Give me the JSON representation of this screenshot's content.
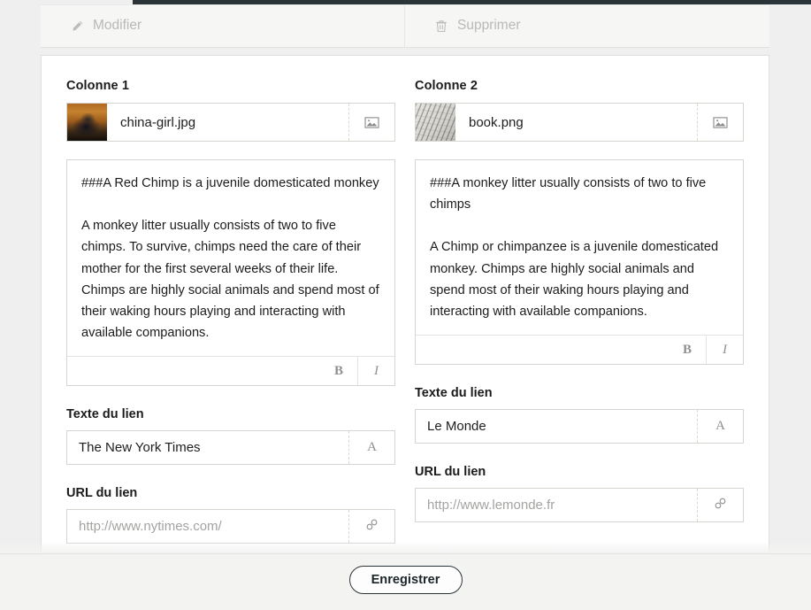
{
  "toolbar": {
    "buttons": [
      {
        "label": "Modifier",
        "icon": "pencil-icon"
      },
      {
        "label": "Supprimer",
        "icon": "trash-icon"
      }
    ]
  },
  "columns": [
    {
      "title": "Colonne 1",
      "file": {
        "name": "china-girl.jpg",
        "button_icon": "image-icon"
      },
      "body": {
        "heading": "###A Red Chimp is a juvenile domesticated monkey",
        "paragraph": "A monkey litter usually consists of two to five chimps. To survive, chimps need the care of their mother for the first several weeks of their life. Chimps are highly social animals and spend most of their waking hours playing and interacting with available companions.",
        "tools": {
          "bold": "B",
          "italic": "I"
        }
      },
      "link_text": {
        "label": "Texte du lien",
        "value": "The New York Times",
        "button_icon": "text-format-icon",
        "button_glyph": "A"
      },
      "link_url": {
        "label": "URL du lien",
        "value": "http://www.nytimes.com/",
        "is_placeholder": true,
        "button_icon": "link-icon"
      }
    },
    {
      "title": "Colonne 2",
      "file": {
        "name": "book.png",
        "button_icon": "image-icon"
      },
      "body": {
        "heading": "###A monkey litter usually consists of two to five chimps",
        "paragraph": "A Chimp or chimpanzee is a juvenile domesticated monkey. Chimps are highly social animals and spend most of their waking hours playing and interacting with available companions.",
        "tools": {
          "bold": "B",
          "italic": "I"
        }
      },
      "link_text": {
        "label": "Texte du lien",
        "value": "Le Monde",
        "button_icon": "text-format-icon",
        "button_glyph": "A"
      },
      "link_url": {
        "label": "URL du lien",
        "value": "http://www.lemonde.fr",
        "is_placeholder": true,
        "button_icon": "link-icon"
      }
    }
  ],
  "footer": {
    "save_label": "Enregistrer"
  },
  "colors": {
    "page_background": "#efefef",
    "card_background": "#ffffff",
    "toolbar_background": "#f6f6f5",
    "toolbar_text": "#b9b9b7",
    "border": "#d6d6d0",
    "text": "#1b1b1b",
    "placeholder": "#a3a3a1",
    "save_button_border": "#2b3539",
    "top_strip": "#2b3539"
  }
}
